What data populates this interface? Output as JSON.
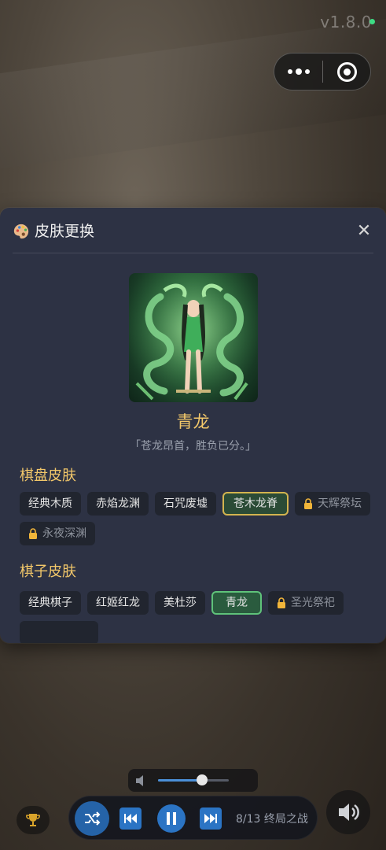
{
  "app": {
    "version": "v1.8.0"
  },
  "capsule": {
    "more_icon": "more-dots-icon",
    "close_icon": "target-close-icon"
  },
  "skin_panel": {
    "title": "皮肤更换",
    "title_icon": "palette-icon",
    "close_label": "✕",
    "current_skin": {
      "name": "青龙",
      "quote": "「苍龙昂首，胜负已分。」"
    },
    "board_section": {
      "title": "棋盘皮肤",
      "items": [
        {
          "label": "经典木质",
          "locked": false,
          "selected": false
        },
        {
          "label": "赤焰龙渊",
          "locked": false,
          "selected": false
        },
        {
          "label": "石咒废墟",
          "locked": false,
          "selected": false
        },
        {
          "label": "苍木龙脊",
          "locked": false,
          "selected": true
        },
        {
          "label": "天辉祭坛",
          "locked": true,
          "selected": false
        },
        {
          "label": "永夜深渊",
          "locked": true,
          "selected": false
        }
      ]
    },
    "piece_section": {
      "title": "棋子皮肤",
      "items": [
        {
          "label": "经典棋子",
          "locked": false,
          "selected": false
        },
        {
          "label": "红姬红龙",
          "locked": false,
          "selected": false
        },
        {
          "label": "美杜莎",
          "locked": false,
          "selected": false
        },
        {
          "label": "青龙",
          "locked": false,
          "selected": true
        },
        {
          "label": "圣光祭祀",
          "locked": true,
          "selected": false
        }
      ]
    }
  },
  "player": {
    "track_info": "8/13 终局之战",
    "volume_fraction": 0.62,
    "colors": {
      "accent": "#2b74c4",
      "gold": "#f3c86a"
    }
  }
}
